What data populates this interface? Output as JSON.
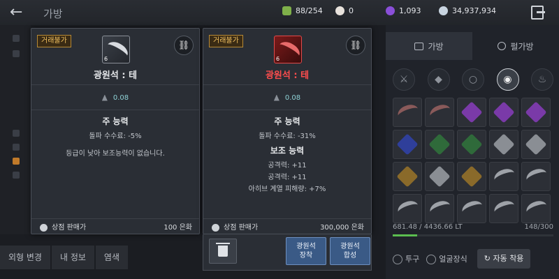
{
  "header": {
    "back_icon": "back-arrow-icon",
    "title": "가방",
    "weight_count": "88/254",
    "currency_1": "0",
    "currency_2": "1,093",
    "silver": "34,937,934",
    "exit_icon": "exit-icon"
  },
  "left_bottom_tabs": [
    "외형 변경",
    "내 정보",
    "염색"
  ],
  "right_panel": {
    "tab_bag": "가방",
    "tab_pet": "펄가방",
    "weight": "681.48 / 4436.66 LT",
    "slots": "148/300",
    "weight_fill": 0.15,
    "helmet_label": "투구",
    "face_label": "얼굴장식",
    "auto_equip": "자동 착용"
  },
  "tooltip_left": {
    "trade_badge": "거래불가",
    "level": "6",
    "name": "광원석 : 테",
    "weight": "0.08",
    "main_title": "주 능력",
    "main_line": "돌파 수수료: -5%",
    "note": "등급이 낮아 보조능력이 없습니다.",
    "sell_label": "상점 판매가",
    "sell_value": "100 은화"
  },
  "tooltip_right": {
    "trade_badge": "거래불가",
    "level": "6",
    "name": "광원석 : 테",
    "weight": "0.08",
    "main_title": "주 능력",
    "main_line": "돌파 수수료: -31%",
    "sub_title": "보조 능력",
    "sub_lines": [
      "공격력: +11",
      "공격력: +11",
      "아히브 계열 피해량: +7%"
    ],
    "sell_label": "상점 판매가",
    "sell_value": "300,000 은화"
  },
  "actions": {
    "equip_line1": "광원석",
    "equip_line2": "장착",
    "merge_line1": "광원석",
    "merge_line2": "합성"
  },
  "colors": {
    "name_red": "#ff4d4d",
    "weight_cyan": "#8fd2d6",
    "badge_gold": "#f0c060",
    "button_blue": "#3a5a86"
  }
}
